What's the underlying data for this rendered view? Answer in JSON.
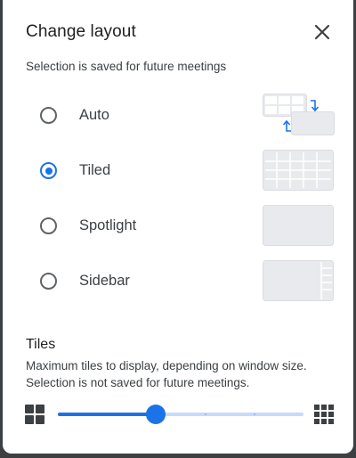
{
  "dialog": {
    "title": "Change layout",
    "subtitle": "Selection is saved for future meetings",
    "options": [
      {
        "label": "Auto",
        "selected": false,
        "preview_icon": "auto-layout-icon"
      },
      {
        "label": "Tiled",
        "selected": true,
        "preview_icon": "tiled-layout-icon"
      },
      {
        "label": "Spotlight",
        "selected": false,
        "preview_icon": "spotlight-layout-icon"
      },
      {
        "label": "Sidebar",
        "selected": false,
        "preview_icon": "sidebar-layout-icon"
      }
    ]
  },
  "tiles": {
    "heading": "Tiles",
    "description_line1": "Maximum tiles to display, depending on window size.",
    "description_line2": "Selection is not saved for future meetings.",
    "slider": {
      "value_fraction": 0.4,
      "steps": 6,
      "min_icon": "grid-small-icon",
      "max_icon": "grid-large-icon"
    }
  },
  "colors": {
    "accent": "#1a73e8",
    "track": "#c6dafc",
    "preview_fill": "#e8eaed",
    "preview_border": "#dadce0",
    "text": "#3c4043"
  }
}
